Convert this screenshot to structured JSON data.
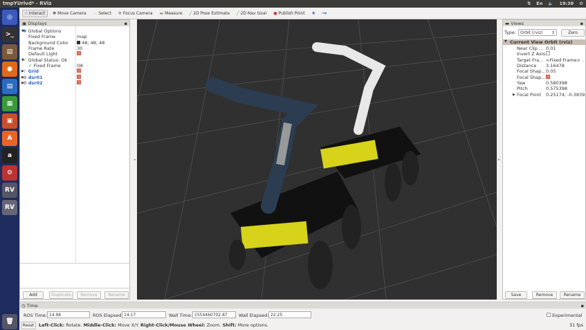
{
  "window": {
    "title": "tmpYUrlvd* - RViz",
    "clock": "19:38",
    "keyboard": "En"
  },
  "toolbar": [
    {
      "label": "Interact",
      "icon": "hand-icon"
    },
    {
      "label": "Move Camera",
      "icon": "move-icon"
    },
    {
      "label": "Select",
      "icon": "select-icon"
    },
    {
      "label": "Focus Camera",
      "icon": "focus-icon"
    },
    {
      "label": "Measure",
      "icon": "ruler-icon"
    },
    {
      "label": "2D Pose Estimate",
      "icon": "arrow-green-icon"
    },
    {
      "label": "2D Nav Goal",
      "icon": "arrow-green-icon"
    },
    {
      "label": "Publish Point",
      "icon": "pin-icon"
    }
  ],
  "displays": {
    "title": "Displays",
    "rows": [
      {
        "label": "Global Options",
        "value": "",
        "indent": 1,
        "icon": "gear-icon",
        "expand": "▼"
      },
      {
        "label": "Fixed Frame",
        "value": "map",
        "indent": 2
      },
      {
        "label": "Background Color",
        "value": "48; 48; 48",
        "indent": 2,
        "swatch": "#303030"
      },
      {
        "label": "Frame Rate",
        "value": "30",
        "indent": 2
      },
      {
        "label": "Default Light",
        "value": "",
        "indent": 2,
        "check": true
      },
      {
        "label": "Global Status: Ok",
        "value": "",
        "indent": 1,
        "icon": "check-icon",
        "expand": "▼"
      },
      {
        "label": "Fixed Frame",
        "value": "OK",
        "indent": 2,
        "icon": "check-icon",
        "bold": true
      },
      {
        "label": "Grid",
        "value": "",
        "indent": 1,
        "icon": "grid-icon",
        "expand": "▶",
        "blue": true,
        "check": true
      },
      {
        "label": "dsr01",
        "value": "",
        "indent": 1,
        "icon": "robot-icon",
        "expand": "▶",
        "blue": true,
        "check": true
      },
      {
        "label": "dsr02",
        "value": "",
        "indent": 1,
        "icon": "robot-icon",
        "expand": "▶",
        "blue": true,
        "check": true
      }
    ],
    "buttons": {
      "add": "Add",
      "duplicate": "Duplicate",
      "remove": "Remove",
      "rename": "Rename"
    }
  },
  "views": {
    "title": "Views",
    "type_label": "Type:",
    "type_value": "Orbit (rviz)",
    "zero": "Zero",
    "header": {
      "label": "Current View",
      "value": "Orbit (rviz)"
    },
    "rows": [
      {
        "label": "Near Clip ...",
        "value": "0.01"
      },
      {
        "label": "Invert Z Axis",
        "value": "",
        "check": false
      },
      {
        "label": "Target Fra...",
        "value": "<Fixed Frame>"
      },
      {
        "label": "Distance",
        "value": "3.16478"
      },
      {
        "label": "Focal Shap...",
        "value": "0.05"
      },
      {
        "label": "Focal Shap...",
        "value": "",
        "check": true
      },
      {
        "label": "Yaw",
        "value": "0.580398"
      },
      {
        "label": "Pitch",
        "value": "0.575398"
      },
      {
        "label": "Focal Point",
        "value": "0.25174; -0.3839...",
        "expand": "▶"
      }
    ],
    "buttons": {
      "save": "Save",
      "remove": "Remove",
      "rename": "Rename"
    }
  },
  "time": {
    "title": "Time",
    "ros_time_label": "ROS Time:",
    "ros_time": "14.96",
    "ros_elapsed_label": "ROS Elapsed:",
    "ros_elapsed": "14.17",
    "wall_time_label": "Wall Time:",
    "wall_time": "1554460702.87",
    "wall_elapsed_label": "Wall Elapsed:",
    "wall_elapsed": "22.25",
    "experimental": "Experimental"
  },
  "status": {
    "reset": "Reset",
    "k1": "Left-Click:",
    "v1": " Rotate. ",
    "k2": "Middle-Click:",
    "v2": " Move X/Y. ",
    "k3": "Right-Click/Mouse Wheel:",
    "v3": " Zoom. ",
    "k4": "Shift:",
    "v4": " More options.",
    "fps": "31 fps"
  }
}
